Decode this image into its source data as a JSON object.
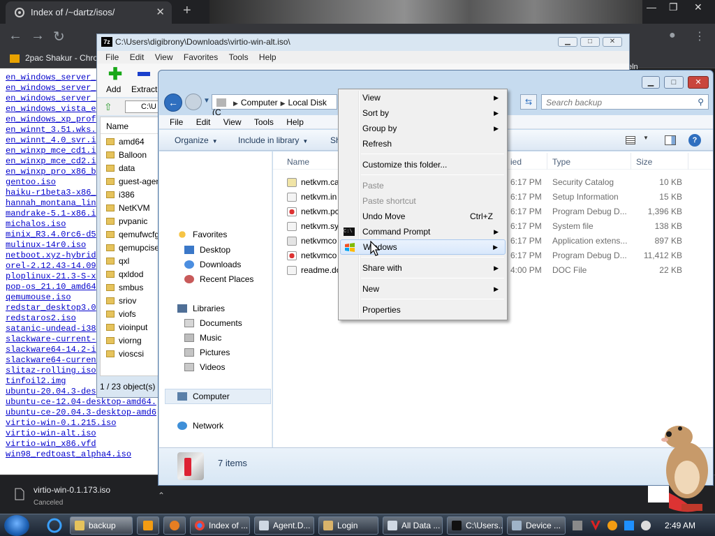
{
  "chrome": {
    "tab_title": "Index of /~dartz/isos/",
    "bookmark": "2pac Shakur - Chro",
    "ext_text": "eln",
    "download": {
      "filename": "virtio-win-0.1.173.iso",
      "status": "Canceled"
    }
  },
  "directory_listing": [
    "en_windows_server_",
    "en_windows_server_",
    "en_windows_server_",
    "en_windows_vista_e",
    "en_windows_xp_prof",
    "en_winnt_3.51.wks.",
    "en_winnt_4.0_svr.i",
    "en_winxp_mce_cd1.i",
    "en_winxp_mce_cd2.i",
    "en_winxp_pro_x86_b",
    "gentoo.iso",
    "haiku-r1beta3-x86_",
    "hannah_montana_lin",
    "mandrake-5.1-x86.i",
    "michalos.iso",
    "minix_R3.4.0rc6-d5",
    "mulinux-14r0.iso",
    "netboot.xyz-hybrid",
    "orel-2.12.43-14.09",
    "ploplinux-21.3-S-x",
    "pop-os_21.10_amd64",
    "qemumouse.iso",
    "redstar_desktop3.0",
    "redstaros2.iso",
    "satanic-undead-i38",
    "slackware-current-",
    "slackware64-14.2-i",
    "slackware64-current",
    "slitaz-rolling.iso",
    "tinfoil2.img",
    "ubuntu-20.04.3-des",
    "ubuntu-ce-12.04-desktop-amd64.",
    "ubuntu-ce-20.04.3-desktop-amd6",
    "virtio-win-0.1.215.iso",
    "virtio-win-alt.iso",
    "virtio-win_x86.vfd",
    "win98_redtoast_alpha4.iso"
  ],
  "zip": {
    "logo": "7z",
    "title": "C:\\Users\\digibrony\\Downloads\\virtio-win-alt.iso\\",
    "menu": [
      "File",
      "Edit",
      "View",
      "Favorites",
      "Tools",
      "Help"
    ],
    "add_label": "Add",
    "extract_label": "Extract",
    "address": "C:\\U",
    "column_name": "Name",
    "rows": [
      "amd64",
      "Balloon",
      "data",
      "guest-agent",
      "i386",
      "NetKVM",
      "pvpanic",
      "qemufwcfg",
      "qemupciserial",
      "qxl",
      "qxldod",
      "smbus",
      "sriov",
      "viofs",
      "vioinput",
      "viorng",
      "vioscsi"
    ],
    "status": "1 / 23 object(s)"
  },
  "explorer": {
    "breadcrumb": [
      "Computer",
      "Local Disk (C"
    ],
    "search_placeholder": "Search backup",
    "menu": [
      "File",
      "Edit",
      "View",
      "Tools",
      "Help"
    ],
    "cmd": {
      "organize": "Organize",
      "include": "Include in library",
      "share": "Sh"
    },
    "nav": {
      "favorites": "Favorites",
      "desktop": "Desktop",
      "downloads": "Downloads",
      "recent": "Recent Places",
      "libraries": "Libraries",
      "documents": "Documents",
      "music": "Music",
      "pictures": "Pictures",
      "videos": "Videos",
      "computer": "Computer",
      "network": "Network"
    },
    "columns": {
      "name": "Name",
      "date": "ied",
      "type": "Type",
      "size": "Size"
    },
    "files": [
      {
        "name": "netkvm.ca",
        "date": "6:17 PM",
        "type": "Security Catalog",
        "size": "10 KB"
      },
      {
        "name": "netkvm.in",
        "date": "6:17 PM",
        "type": "Setup Information",
        "size": "15 KB"
      },
      {
        "name": "netkvm.pc",
        "date": "6:17 PM",
        "type": "Program Debug D...",
        "size": "1,396 KB"
      },
      {
        "name": "netkvm.sy",
        "date": "6:17 PM",
        "type": "System file",
        "size": "138 KB"
      },
      {
        "name": "netkvmco",
        "date": "6:17 PM",
        "type": "Application extens...",
        "size": "897 KB"
      },
      {
        "name": "netkvmco",
        "date": "6:17 PM",
        "type": "Program Debug D...",
        "size": "11,412 KB"
      },
      {
        "name": "readme.do",
        "date": "4:00 PM",
        "type": "DOC File",
        "size": "22 KB"
      }
    ],
    "items_count": "7 items"
  },
  "context_menu": {
    "view": "View",
    "sort_by": "Sort by",
    "group_by": "Group by",
    "refresh": "Refresh",
    "customize": "Customize this folder...",
    "paste": "Paste",
    "paste_shortcut": "Paste shortcut",
    "undo_move": "Undo Move",
    "undo_shortcut": "Ctrl+Z",
    "command_prompt": "Command Prompt",
    "windows": "Windows",
    "share_with": "Share with",
    "new": "New",
    "properties": "Properties"
  },
  "taskbar": {
    "buttons": [
      "backup",
      "",
      "",
      "Index of ...",
      "Agent.D...",
      "Login",
      "All Data ...",
      "C:\\Users...",
      "Device ..."
    ],
    "clock": "2:49 AM"
  },
  "colors": {
    "explorer_frame": "#c6dbef",
    "taskbar": "#1b2330",
    "link": "#0000cc",
    "menu_highlight": "#d9e8fb"
  }
}
